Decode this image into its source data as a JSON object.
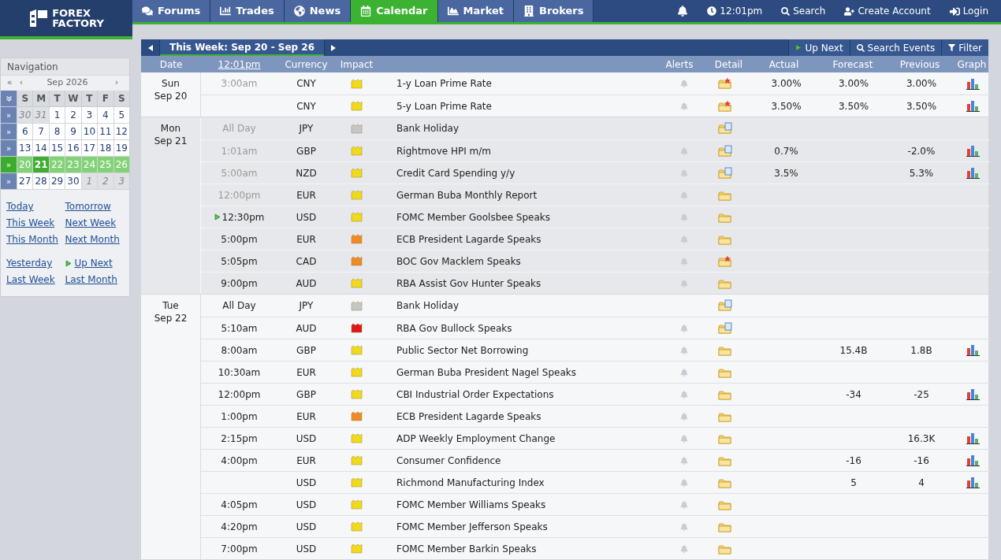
{
  "logo": {
    "line1": "FOREX",
    "line2": "FACTORY"
  },
  "nav_tabs": [
    {
      "label": "Forums",
      "selected": false
    },
    {
      "label": "Trades",
      "selected": false
    },
    {
      "label": "News",
      "selected": false
    },
    {
      "label": "Calendar",
      "selected": true
    },
    {
      "label": "Market",
      "selected": false
    },
    {
      "label": "Brokers",
      "selected": false
    }
  ],
  "top_right": {
    "time": "12:01pm",
    "search": "Search",
    "create_account": "Create Account",
    "login": "Login"
  },
  "sidebar": {
    "title": "Navigation",
    "prev_year": "«",
    "prev_month": "‹",
    "month": "Sep 2026",
    "next_month": "›",
    "weekdays": [
      "S",
      "M",
      "T",
      "W",
      "T",
      "F",
      "S"
    ],
    "weeks": [
      {
        "selected": false,
        "expand": "»",
        "days": [
          {
            "label": "30",
            "muted": true,
            "today": false
          },
          {
            "label": "31",
            "muted": true,
            "today": false
          },
          {
            "label": "1",
            "muted": false,
            "today": false
          },
          {
            "label": "2",
            "muted": false,
            "today": false
          },
          {
            "label": "3",
            "muted": false,
            "today": false
          },
          {
            "label": "4",
            "muted": false,
            "today": false
          },
          {
            "label": "5",
            "muted": false,
            "today": false
          }
        ]
      },
      {
        "selected": false,
        "expand": "»",
        "days": [
          {
            "label": "6",
            "muted": false,
            "today": false
          },
          {
            "label": "7",
            "muted": false,
            "today": false
          },
          {
            "label": "8",
            "muted": false,
            "today": false
          },
          {
            "label": "9",
            "muted": false,
            "today": false
          },
          {
            "label": "10",
            "muted": false,
            "today": false
          },
          {
            "label": "11",
            "muted": false,
            "today": false
          },
          {
            "label": "12",
            "muted": false,
            "today": false
          }
        ]
      },
      {
        "selected": false,
        "expand": "»",
        "days": [
          {
            "label": "13",
            "muted": false,
            "today": false
          },
          {
            "label": "14",
            "muted": false,
            "today": false
          },
          {
            "label": "15",
            "muted": false,
            "today": false
          },
          {
            "label": "16",
            "muted": false,
            "today": false
          },
          {
            "label": "17",
            "muted": false,
            "today": false
          },
          {
            "label": "18",
            "muted": false,
            "today": false
          },
          {
            "label": "19",
            "muted": false,
            "today": false
          }
        ]
      },
      {
        "selected": true,
        "expand": "»",
        "days": [
          {
            "label": "20",
            "muted": false,
            "today": false
          },
          {
            "label": "21",
            "muted": false,
            "today": true
          },
          {
            "label": "22",
            "muted": false,
            "today": false
          },
          {
            "label": "23",
            "muted": false,
            "today": false
          },
          {
            "label": "24",
            "muted": false,
            "today": false
          },
          {
            "label": "25",
            "muted": false,
            "today": false
          },
          {
            "label": "26",
            "muted": false,
            "today": false
          }
        ]
      },
      {
        "selected": false,
        "expand": "»",
        "days": [
          {
            "label": "27",
            "muted": false,
            "today": false
          },
          {
            "label": "28",
            "muted": false,
            "today": false
          },
          {
            "label": "29",
            "muted": false,
            "today": false
          },
          {
            "label": "30",
            "muted": false,
            "today": false
          },
          {
            "label": "1",
            "muted": true,
            "today": false
          },
          {
            "label": "2",
            "muted": true,
            "today": false
          },
          {
            "label": "3",
            "muted": true,
            "today": false
          }
        ]
      }
    ],
    "link_groups": [
      [
        {
          "label": "Today",
          "upnext": false
        },
        {
          "label": "Tomorrow",
          "upnext": false
        },
        {
          "label": "This Week",
          "upnext": false
        },
        {
          "label": "Next Week",
          "upnext": false
        },
        {
          "label": "This Month",
          "upnext": false
        },
        {
          "label": "Next Month",
          "upnext": false
        }
      ],
      [
        {
          "label": "Yesterday",
          "upnext": false
        },
        {
          "label": "Up Next",
          "upnext": true
        },
        {
          "label": "Last Week",
          "upnext": false
        },
        {
          "label": "Last Month",
          "upnext": false
        }
      ]
    ]
  },
  "toolbar": {
    "week": "This Week: Sep 20 - Sep 26",
    "up_next": "Up Next",
    "search_events": "Search Events",
    "filter": "Filter"
  },
  "columns": [
    "Date",
    "12:01pm",
    "Currency",
    "Impact",
    "Alerts",
    "Detail",
    "Actual",
    "Forecast",
    "Previous",
    "Graph"
  ],
  "days": [
    {
      "weekday": "Sun",
      "date": "Sep 20",
      "today": false,
      "events": [
        {
          "time": "3:00am",
          "past": true,
          "upnext": false,
          "currency": "CNY",
          "impact": {
            "kind": "low"
          },
          "title": "1-y Loan Prime Rate",
          "alert": true,
          "detail": {
            "kind": "star"
          },
          "actual": "3.00%",
          "forecast": "3.00%",
          "previous": "3.00%",
          "graph": true
        },
        {
          "upnext": false,
          "currency": "CNY",
          "impact": {
            "kind": "low"
          },
          "title": "5-y Loan Prime Rate",
          "alert": true,
          "detail": {
            "kind": "star"
          },
          "actual": "3.50%",
          "forecast": "3.50%",
          "previous": "3.50%",
          "graph": true
        }
      ]
    },
    {
      "weekday": "Mon",
      "date": "Sep 21",
      "today": true,
      "events": [
        {
          "time": "All Day",
          "past": true,
          "upnext": false,
          "currency": "JPY",
          "impact": {
            "kind": "holiday"
          },
          "title": "Bank Holiday",
          "alert": false,
          "detail": {
            "kind": "doc"
          },
          "graph": false
        },
        {
          "time": "1:01am",
          "past": true,
          "upnext": false,
          "currency": "GBP",
          "impact": {
            "kind": "low"
          },
          "title": "Rightmove HPI m/m",
          "alert": true,
          "detail": {
            "kind": "doc"
          },
          "actual": "0.7%",
          "previous": "-2.0%",
          "graph": true
        },
        {
          "time": "5:00am",
          "past": true,
          "upnext": false,
          "currency": "NZD",
          "impact": {
            "kind": "low"
          },
          "title": "Credit Card Spending y/y",
          "alert": true,
          "detail": {
            "kind": "doc"
          },
          "actual": "3.5%",
          "previous": "5.3%",
          "graph": true
        },
        {
          "time": "12:00pm",
          "past": true,
          "upnext": false,
          "currency": "EUR",
          "impact": {
            "kind": "low"
          },
          "title": "German Buba Monthly Report",
          "alert": true,
          "detail": {
            "kind": "plain"
          },
          "graph": false
        },
        {
          "time": "12:30pm",
          "past": false,
          "upnext": true,
          "currency": "USD",
          "impact": {
            "kind": "low"
          },
          "title": "FOMC Member Goolsbee Speaks",
          "alert": true,
          "detail": {
            "kind": "plain"
          },
          "graph": false
        },
        {
          "time": "5:00pm",
          "past": false,
          "upnext": false,
          "currency": "EUR",
          "impact": {
            "kind": "medium"
          },
          "title": "ECB President Lagarde Speaks",
          "alert": true,
          "detail": {
            "kind": "plain"
          },
          "graph": false
        },
        {
          "time": "5:05pm",
          "past": false,
          "upnext": false,
          "currency": "CAD",
          "impact": {
            "kind": "medium"
          },
          "title": "BOC Gov Macklem Speaks",
          "alert": true,
          "detail": {
            "kind": "star"
          },
          "graph": false
        },
        {
          "time": "9:00pm",
          "past": false,
          "upnext": false,
          "currency": "AUD",
          "impact": {
            "kind": "low"
          },
          "title": "RBA Assist Gov Hunter Speaks",
          "alert": true,
          "detail": {
            "kind": "plain"
          },
          "graph": false
        }
      ]
    },
    {
      "weekday": "Tue",
      "date": "Sep 22",
      "today": false,
      "events": [
        {
          "time": "All Day",
          "past": false,
          "upnext": false,
          "currency": "JPY",
          "impact": {
            "kind": "holiday"
          },
          "title": "Bank Holiday",
          "alert": false,
          "detail": {
            "kind": "doc"
          },
          "graph": false
        },
        {
          "time": "5:10am",
          "past": false,
          "upnext": false,
          "currency": "AUD",
          "impact": {
            "kind": "high"
          },
          "title": "RBA Gov Bullock Speaks",
          "alert": true,
          "detail": {
            "kind": "doc"
          },
          "graph": false
        },
        {
          "time": "8:00am",
          "past": false,
          "upnext": false,
          "currency": "GBP",
          "impact": {
            "kind": "low"
          },
          "title": "Public Sector Net Borrowing",
          "alert": true,
          "detail": {
            "kind": "plain"
          },
          "forecast": "15.4B",
          "previous": "1.8B",
          "graph": true
        },
        {
          "time": "10:30am",
          "past": false,
          "upnext": false,
          "currency": "EUR",
          "impact": {
            "kind": "low"
          },
          "title": "German Buba President Nagel Speaks",
          "alert": true,
          "detail": {
            "kind": "plain"
          },
          "graph": false
        },
        {
          "time": "12:00pm",
          "past": false,
          "upnext": false,
          "currency": "GBP",
          "impact": {
            "kind": "low"
          },
          "title": "CBI Industrial Order Expectations",
          "alert": true,
          "detail": {
            "kind": "plain"
          },
          "forecast": "-34",
          "previous": "-25",
          "graph": true
        },
        {
          "time": "1:00pm",
          "past": false,
          "upnext": false,
          "currency": "EUR",
          "impact": {
            "kind": "medium"
          },
          "title": "ECB President Lagarde Speaks",
          "alert": true,
          "detail": {
            "kind": "plain"
          },
          "graph": false
        },
        {
          "time": "2:15pm",
          "past": false,
          "upnext": false,
          "currency": "USD",
          "impact": {
            "kind": "low"
          },
          "title": "ADP Weekly Employment Change",
          "alert": true,
          "detail": {
            "kind": "plain"
          },
          "previous": "16.3K",
          "graph": true
        },
        {
          "time": "4:00pm",
          "past": false,
          "upnext": false,
          "currency": "EUR",
          "impact": {
            "kind": "low"
          },
          "title": "Consumer Confidence",
          "alert": true,
          "detail": {
            "kind": "plain"
          },
          "forecast": "-16",
          "previous": "-16",
          "graph": true
        },
        {
          "upnext": false,
          "currency": "USD",
          "impact": {
            "kind": "low"
          },
          "title": "Richmond Manufacturing Index",
          "alert": true,
          "detail": {
            "kind": "plain"
          },
          "forecast": "5",
          "previous": "4",
          "graph": true
        },
        {
          "time": "4:05pm",
          "past": false,
          "upnext": false,
          "currency": "USD",
          "impact": {
            "kind": "low"
          },
          "title": "FOMC Member Williams Speaks",
          "alert": true,
          "detail": {
            "kind": "plain"
          },
          "graph": false
        },
        {
          "time": "4:20pm",
          "past": false,
          "upnext": false,
          "currency": "USD",
          "impact": {
            "kind": "low"
          },
          "title": "FOMC Member Jefferson Speaks",
          "alert": true,
          "detail": {
            "kind": "plain"
          },
          "graph": false
        },
        {
          "time": "7:00pm",
          "past": false,
          "upnext": false,
          "currency": "USD",
          "impact": {
            "kind": "low"
          },
          "title": "FOMC Member Barkin Speaks",
          "alert": true,
          "detail": {
            "kind": "plain"
          },
          "graph": false
        }
      ]
    }
  ]
}
